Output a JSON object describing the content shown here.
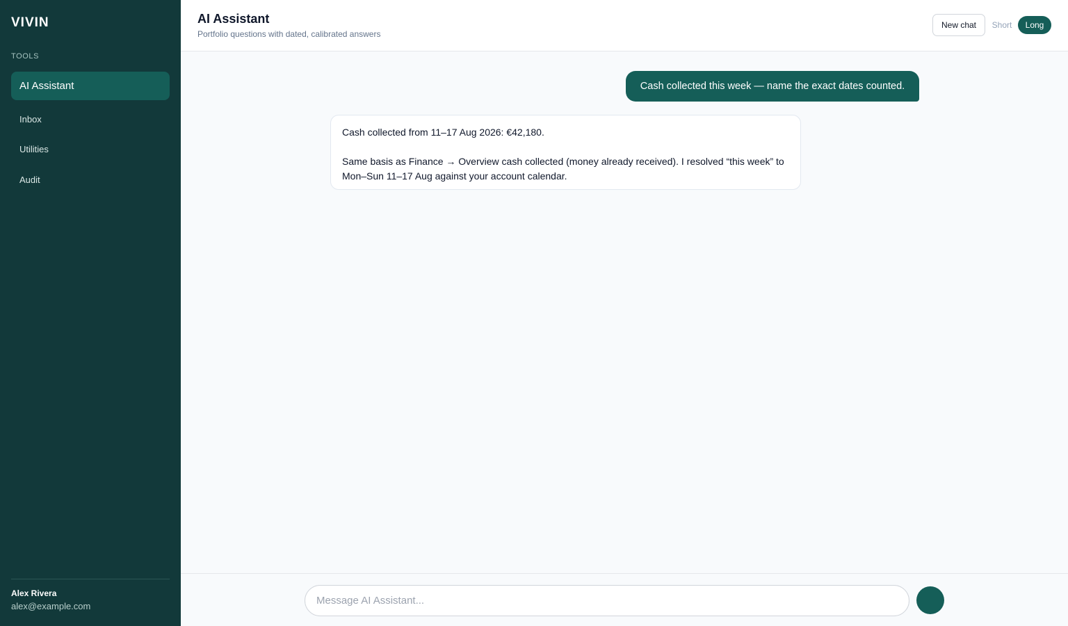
{
  "sidebar": {
    "brand": "VIVIN",
    "section_label": "TOOLS",
    "items": [
      {
        "label": "AI Assistant",
        "active": true
      },
      {
        "label": "Inbox"
      },
      {
        "label": "Utilities"
      },
      {
        "label": "Audit"
      }
    ],
    "user": {
      "name": "Alex Rivera",
      "email": "alex@example.com"
    }
  },
  "header": {
    "title": "AI Assistant",
    "subtitle": "Portfolio questions with dated, calibrated answers",
    "new_chat_label": "New chat",
    "length_options": [
      "Short",
      "Long"
    ],
    "selected_length": "Long"
  },
  "conversation": {
    "messages": [
      {
        "role": "user",
        "text": "Cash collected this week — name the exact dates counted."
      },
      {
        "role": "assistant",
        "paragraphs": [
          "Cash collected from 11–17 Aug 2026: €42,180.",
          "Same basis as Finance → Overview cash collected (money already received). I resolved “this week” to Mon–Sun 11–17 Aug against your account calendar."
        ]
      }
    ]
  },
  "composer": {
    "placeholder": "Message AI Assistant...",
    "value": ""
  },
  "colors": {
    "sidebar_bg": "#12393a",
    "accent": "#155e58",
    "page_bg": "#f8fafc"
  }
}
